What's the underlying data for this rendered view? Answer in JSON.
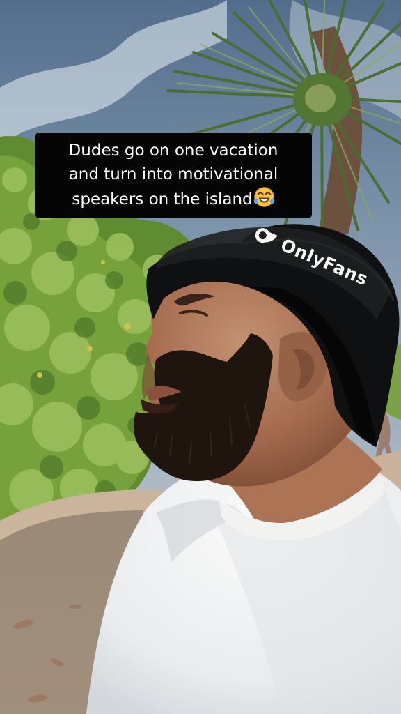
{
  "caption": {
    "line1": "Dudes go on one vacation",
    "line2": "and turn into motivational",
    "line3": "speakers on the island",
    "emoji": "laughing-crying-emoji"
  },
  "photo": {
    "hat_logo_text": "OnlyFans",
    "colors": {
      "sky": "#7f96ae",
      "foliage": "#79a53d",
      "hat": "#101113",
      "shirt": "#f2f3f5",
      "skin": "#b77d5f",
      "beard": "#211510",
      "sand": "#d8c1a5"
    }
  }
}
